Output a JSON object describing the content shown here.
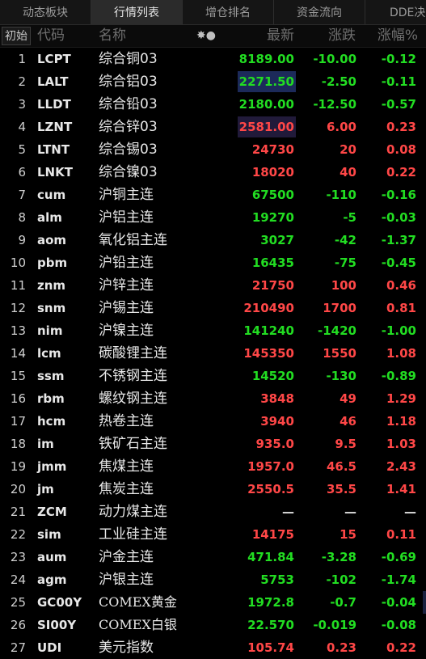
{
  "tabs": [
    {
      "label": "动态板块"
    },
    {
      "label": "行情列表",
      "active": true
    },
    {
      "label": "增仓排名"
    },
    {
      "label": "资金流向"
    },
    {
      "label": "DDE决策"
    }
  ],
  "header": {
    "init_button": "初始",
    "code": "代码",
    "name": "名称",
    "icon_glyph": "✸●",
    "price": "最新",
    "change": "涨跌",
    "pct": "涨幅%"
  },
  "colors": {
    "up": "#ff4747",
    "down": "#22dd22",
    "flat": "#dcdcdc"
  },
  "rows": [
    {
      "idx": "1",
      "code": "LCPT",
      "name": "综合铜03",
      "price": "8189.00",
      "change": "-10.00",
      "pct": "-0.12",
      "dir": "down"
    },
    {
      "idx": "2",
      "code": "LALT",
      "name": "综合铝03",
      "price": "2271.50",
      "change": "-2.50",
      "pct": "-0.11",
      "dir": "down",
      "hl": "blue"
    },
    {
      "idx": "3",
      "code": "LLDT",
      "name": "综合铅03",
      "price": "2180.00",
      "change": "-12.50",
      "pct": "-0.57",
      "dir": "down"
    },
    {
      "idx": "4",
      "code": "LZNT",
      "name": "综合锌03",
      "price": "2581.00",
      "change": "6.00",
      "pct": "0.23",
      "dir": "up",
      "hl": "purple"
    },
    {
      "idx": "5",
      "code": "LTNT",
      "name": "综合锡03",
      "price": "24730",
      "change": "20",
      "pct": "0.08",
      "dir": "up"
    },
    {
      "idx": "6",
      "code": "LNKT",
      "name": "综合镍03",
      "price": "18020",
      "change": "40",
      "pct": "0.22",
      "dir": "up"
    },
    {
      "idx": "7",
      "code": "cum",
      "name": "沪铜主连",
      "price": "67500",
      "change": "-110",
      "pct": "-0.16",
      "dir": "down"
    },
    {
      "idx": "8",
      "code": "alm",
      "name": "沪铝主连",
      "price": "19270",
      "change": "-5",
      "pct": "-0.03",
      "dir": "down"
    },
    {
      "idx": "9",
      "code": "aom",
      "name": "氧化铝主连",
      "price": "3027",
      "change": "-42",
      "pct": "-1.37",
      "dir": "down"
    },
    {
      "idx": "10",
      "code": "pbm",
      "name": "沪铅主连",
      "price": "16435",
      "change": "-75",
      "pct": "-0.45",
      "dir": "down"
    },
    {
      "idx": "11",
      "code": "znm",
      "name": "沪锌主连",
      "price": "21750",
      "change": "100",
      "pct": "0.46",
      "dir": "up"
    },
    {
      "idx": "12",
      "code": "snm",
      "name": "沪锡主连",
      "price": "210490",
      "change": "1700",
      "pct": "0.81",
      "dir": "up"
    },
    {
      "idx": "13",
      "code": "nim",
      "name": "沪镍主连",
      "price": "141240",
      "change": "-1420",
      "pct": "-1.00",
      "dir": "down"
    },
    {
      "idx": "14",
      "code": "lcm",
      "name": "碳酸锂主连",
      "price": "145350",
      "change": "1550",
      "pct": "1.08",
      "dir": "up"
    },
    {
      "idx": "15",
      "code": "ssm",
      "name": "不锈钢主连",
      "price": "14520",
      "change": "-130",
      "pct": "-0.89",
      "dir": "down"
    },
    {
      "idx": "16",
      "code": "rbm",
      "name": "螺纹钢主连",
      "price": "3848",
      "change": "49",
      "pct": "1.29",
      "dir": "up"
    },
    {
      "idx": "17",
      "code": "hcm",
      "name": "热卷主连",
      "price": "3940",
      "change": "46",
      "pct": "1.18",
      "dir": "up"
    },
    {
      "idx": "18",
      "code": "im",
      "name": "铁矿石主连",
      "price": "935.0",
      "change": "9.5",
      "pct": "1.03",
      "dir": "up"
    },
    {
      "idx": "19",
      "code": "jmm",
      "name": "焦煤主连",
      "price": "1957.0",
      "change": "46.5",
      "pct": "2.43",
      "dir": "up"
    },
    {
      "idx": "20",
      "code": "jm",
      "name": "焦炭主连",
      "price": "2550.5",
      "change": "35.5",
      "pct": "1.41",
      "dir": "up"
    },
    {
      "idx": "21",
      "code": "ZCM",
      "name": "动力煤主连",
      "price": "—",
      "change": "—",
      "pct": "—",
      "dir": "flat"
    },
    {
      "idx": "22",
      "code": "sim",
      "name": "工业硅主连",
      "price": "14175",
      "change": "15",
      "pct": "0.11",
      "dir": "up"
    },
    {
      "idx": "23",
      "code": "aum",
      "name": "沪金主连",
      "price": "471.84",
      "change": "-3.28",
      "pct": "-0.69",
      "dir": "down"
    },
    {
      "idx": "24",
      "code": "agm",
      "name": "沪银主连",
      "price": "5753",
      "change": "-102",
      "pct": "-1.74",
      "dir": "down"
    },
    {
      "idx": "25",
      "code": "GC00Y",
      "name": "COMEX黄金",
      "price": "1972.8",
      "change": "-0.7",
      "pct": "-0.04",
      "dir": "down",
      "latin": true,
      "edge": true
    },
    {
      "idx": "26",
      "code": "SI00Y",
      "name": "COMEX白银",
      "price": "22.570",
      "change": "-0.019",
      "pct": "-0.08",
      "dir": "down",
      "latin": true
    },
    {
      "idx": "27",
      "code": "UDI",
      "name": "美元指数",
      "price": "105.74",
      "change": "0.23",
      "pct": "0.22",
      "dir": "up"
    }
  ]
}
